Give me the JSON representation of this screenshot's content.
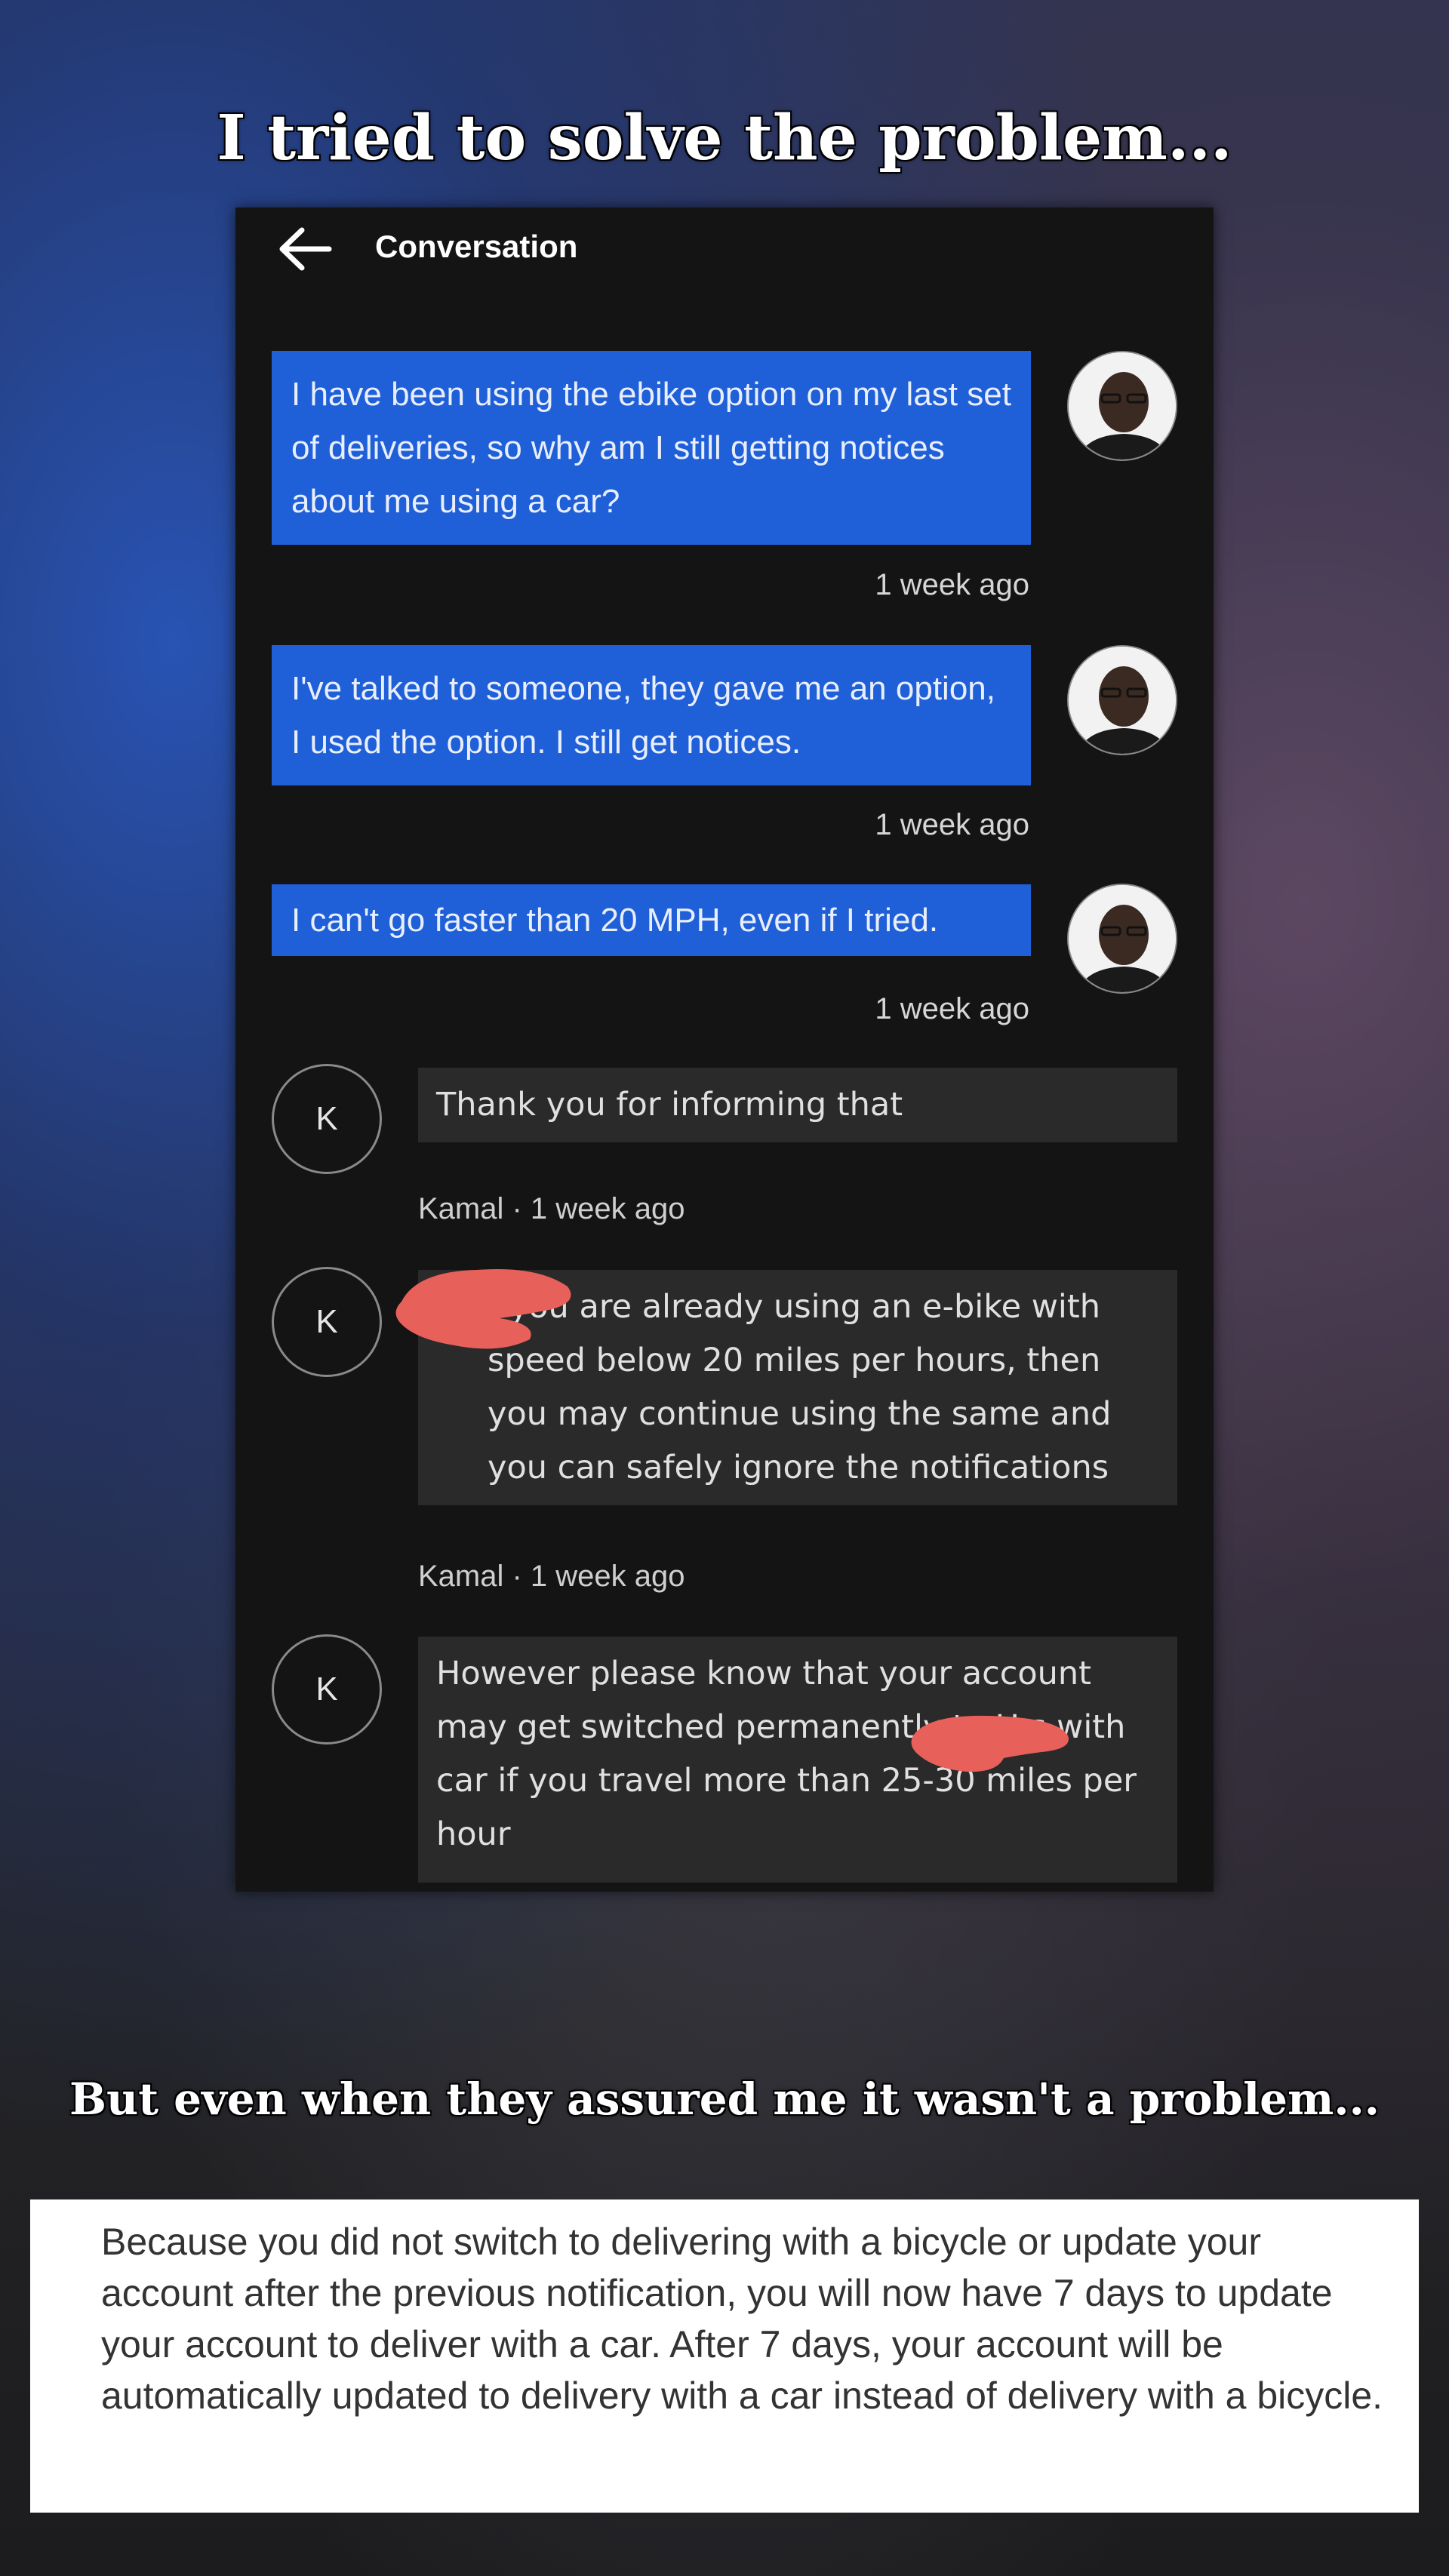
{
  "captions": {
    "top": "I tried to solve the problem...",
    "middle": "But even when they assured me it wasn't a problem..."
  },
  "header": {
    "back_icon": "arrow-left-icon",
    "title": "Conversation"
  },
  "messages": [
    {
      "from": "user",
      "text": "I have been using the ebike option on my last set of deliveries, so why am I still getting notices about me using a car?",
      "time": "1 week ago"
    },
    {
      "from": "user",
      "text": "I've talked to someone, they gave me an option, I used the option. I still get notices.",
      "time": "1 week ago"
    },
    {
      "from": "user",
      "text": "I can't go faster than 20 MPH, even if I tried.",
      "time": "1 week ago"
    },
    {
      "from": "agent",
      "avatar_letter": "K",
      "text": "Thank you for informing that",
      "meta": "Kamal · 1 week ago"
    },
    {
      "from": "agent",
      "avatar_letter": "K",
      "text": "f you are already using an e-bike with speed below 20 miles per hours, then you may continue using the same and you can safely ignore the notifications",
      "meta": "Kamal · 1 week ago"
    },
    {
      "from": "agent",
      "avatar_letter": "K",
      "text": "However please know that your account may get switched permanently to U s with car if you travel more than 25-30 miles per hour"
    }
  ],
  "notice": {
    "text": "Because you did not switch to delivering with a bicycle or update your account after the previous notification, you will now have 7 days to update your account to deliver with a car. After 7 days, your account will be automatically updated to delivery with a car instead of delivery with a bicycle."
  },
  "colors": {
    "user_bubble": "#1f5fd8",
    "agent_bubble": "#2a2a2a",
    "panel_bg": "#141414",
    "redaction": "#e8605a"
  }
}
